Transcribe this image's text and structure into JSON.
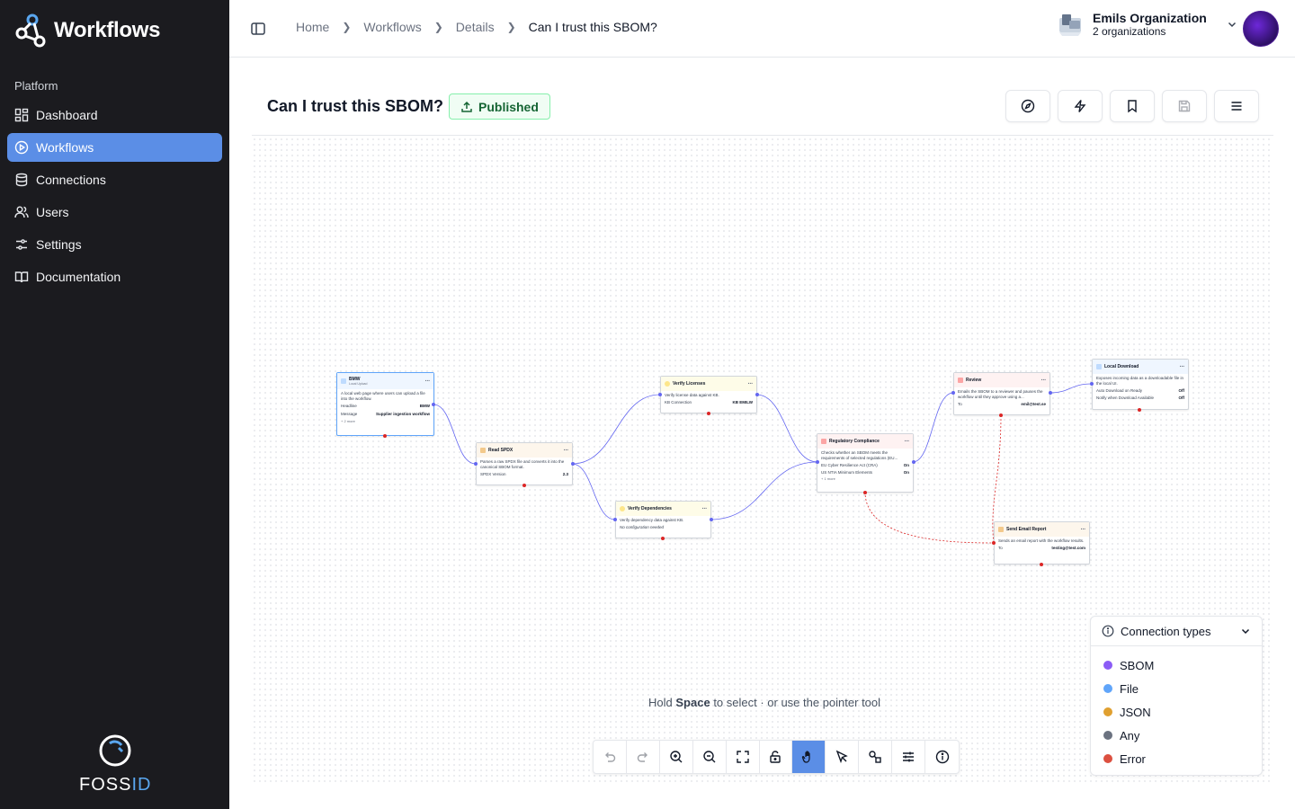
{
  "app": {
    "name": "Workflows"
  },
  "sidebar": {
    "section_label": "Platform",
    "items": [
      {
        "label": "Dashboard",
        "icon": "dashboard-icon"
      },
      {
        "label": "Workflows",
        "icon": "play-circle-icon",
        "active": true
      },
      {
        "label": "Connections",
        "icon": "database-icon"
      },
      {
        "label": "Users",
        "icon": "users-icon"
      },
      {
        "label": "Settings",
        "icon": "sliders-icon"
      },
      {
        "label": "Documentation",
        "icon": "book-icon"
      }
    ],
    "footer_logo": {
      "text_a": "FOSS",
      "text_b": "ID"
    }
  },
  "header": {
    "breadcrumbs": [
      "Home",
      "Workflows",
      "Details",
      "Can I trust this SBOM?"
    ],
    "org_name": "Emils Organization",
    "org_count": "2 organizations"
  },
  "workflow": {
    "title": "Can I trust this SBOM?",
    "status": "Published"
  },
  "nodes": {
    "bmw": {
      "title": "BMW",
      "subtitle": "Local Upload",
      "desc": "A local web page where users can upload a file into the workflow.",
      "k1": "Headline",
      "v1": "BMW",
      "k2": "Message",
      "v2": "Supplier ingestion workflow",
      "more": "+ 2 more"
    },
    "read_spdx": {
      "title": "Read SPDX",
      "desc": "Parses a raw SPDX file and converts it into the canonical SBOM format.",
      "k1": "SPDX Version",
      "v1": "2.3"
    },
    "verify_licenses": {
      "title": "Verify Licenses",
      "desc": "Verify license data against KB.",
      "k1": "KB Connection",
      "v1": "KB EMILW"
    },
    "verify_dependencies": {
      "title": "Verify Dependencies",
      "desc": "Verify dependency data against KB.",
      "note": "No configuration needed"
    },
    "regulatory": {
      "title": "Regulatory Compliance",
      "desc": "Checks whether an SBOM meets the requirements of selected regulations (EU...",
      "k1": "EU Cyber Resilience Act (CRA)",
      "v1": "On",
      "k2": "US NTIA Minimum Elements",
      "v2": "On",
      "more": "+ 1 more"
    },
    "review": {
      "title": "Review",
      "desc": "Emails the SBOM to a reviewer and pauses the workflow until they approve using a...",
      "k1": "To",
      "v1": "emil@test.se"
    },
    "local_download": {
      "title": "Local Download",
      "desc": "Exposes incoming data as a downloadable file in the local UI.",
      "k1": "Auto Download on Ready",
      "v1": "Off",
      "k2": "Notify when Download Available",
      "v2": "Off"
    },
    "send_email": {
      "title": "Send Email Report",
      "desc": "Sends an email report with the workflow results.",
      "k1": "To",
      "v1": "testing@test.com"
    }
  },
  "canvas": {
    "hint_prefix": "Hold",
    "hint_key": "Space",
    "hint_suffix": "to select · or use the pointer tool"
  },
  "legend": {
    "title": "Connection types",
    "items": [
      {
        "label": "SBOM",
        "color": "#8b5cf6"
      },
      {
        "label": "File",
        "color": "#60a5fa"
      },
      {
        "label": "JSON",
        "color": "#e0a030"
      },
      {
        "label": "Any",
        "color": "#6b7280"
      },
      {
        "label": "Error",
        "color": "#dc5040"
      }
    ]
  },
  "colors": {
    "accent": "#5b8ee6",
    "sidebar_bg": "#1b1b1f",
    "published_green": "#166534",
    "edge": "#6366f1",
    "error_edge": "#dc2626"
  }
}
